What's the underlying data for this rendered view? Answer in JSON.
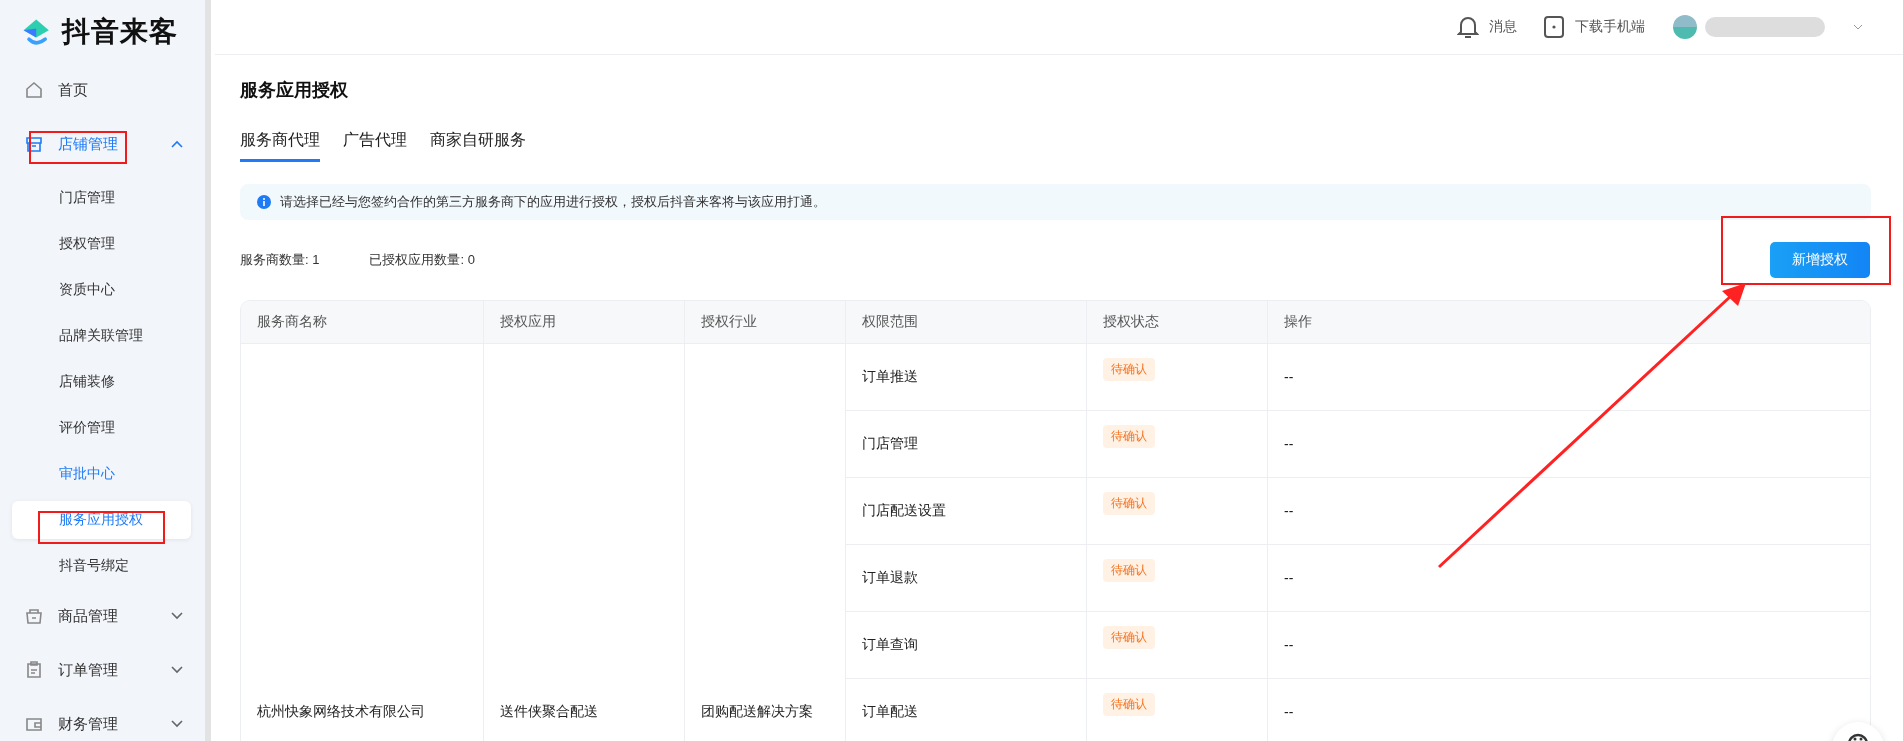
{
  "brand": {
    "name": "抖音来客"
  },
  "sidebar": {
    "items": [
      {
        "label": "首页",
        "kind": "link",
        "selected": false
      },
      {
        "label": "店铺管理",
        "kind": "group",
        "selected": true,
        "expanded": true,
        "children": [
          {
            "label": "门店管理",
            "selected": false
          },
          {
            "label": "授权管理",
            "selected": false
          },
          {
            "label": "资质中心",
            "selected": false
          },
          {
            "label": "品牌关联管理",
            "selected": false
          },
          {
            "label": "店铺装修",
            "selected": false
          },
          {
            "label": "评价管理",
            "selected": false
          },
          {
            "label": "审批中心",
            "selected": false,
            "highlighted": true
          },
          {
            "label": "服务应用授权",
            "selected": true
          },
          {
            "label": "抖音号绑定",
            "selected": false
          }
        ]
      },
      {
        "label": "商品管理",
        "kind": "group",
        "selected": false,
        "expanded": false
      },
      {
        "label": "订单管理",
        "kind": "group",
        "selected": false,
        "expanded": false
      },
      {
        "label": "财务管理",
        "kind": "group",
        "selected": false,
        "expanded": false
      }
    ]
  },
  "header": {
    "messages": "消息",
    "download": "下载手机端"
  },
  "page": {
    "title": "服务应用授权",
    "tabs": [
      {
        "label": "服务商代理",
        "selected": true
      },
      {
        "label": "广告代理",
        "selected": false
      },
      {
        "label": "商家自研服务",
        "selected": false
      }
    ],
    "notice": "请选择已经与您签约合作的第三方服务商下的应用进行授权，授权后抖音来客将与该应用打通。",
    "stats": [
      "服务商数量: 1",
      "已授权应用数量: 0"
    ],
    "add_button": "新增授权"
  },
  "table": {
    "columns": [
      "服务商名称",
      "授权应用",
      "授权行业",
      "权限范围",
      "授权状态",
      "操作"
    ],
    "group": {
      "provider": "杭州快象网络技术有限公司",
      "app": "送件侠聚合配送",
      "industry": "团购配送解决方案"
    },
    "rows": [
      {
        "scope": "订单推送",
        "status": "待确认",
        "action": "--"
      },
      {
        "scope": "门店管理",
        "status": "待确认",
        "action": "--"
      },
      {
        "scope": "门店配送设置",
        "status": "待确认",
        "action": "--"
      },
      {
        "scope": "订单退款",
        "status": "待确认",
        "action": "--"
      },
      {
        "scope": "订单查询",
        "status": "待确认",
        "action": "--"
      },
      {
        "scope": "订单配送",
        "status": "待确认",
        "action": "--"
      }
    ]
  }
}
